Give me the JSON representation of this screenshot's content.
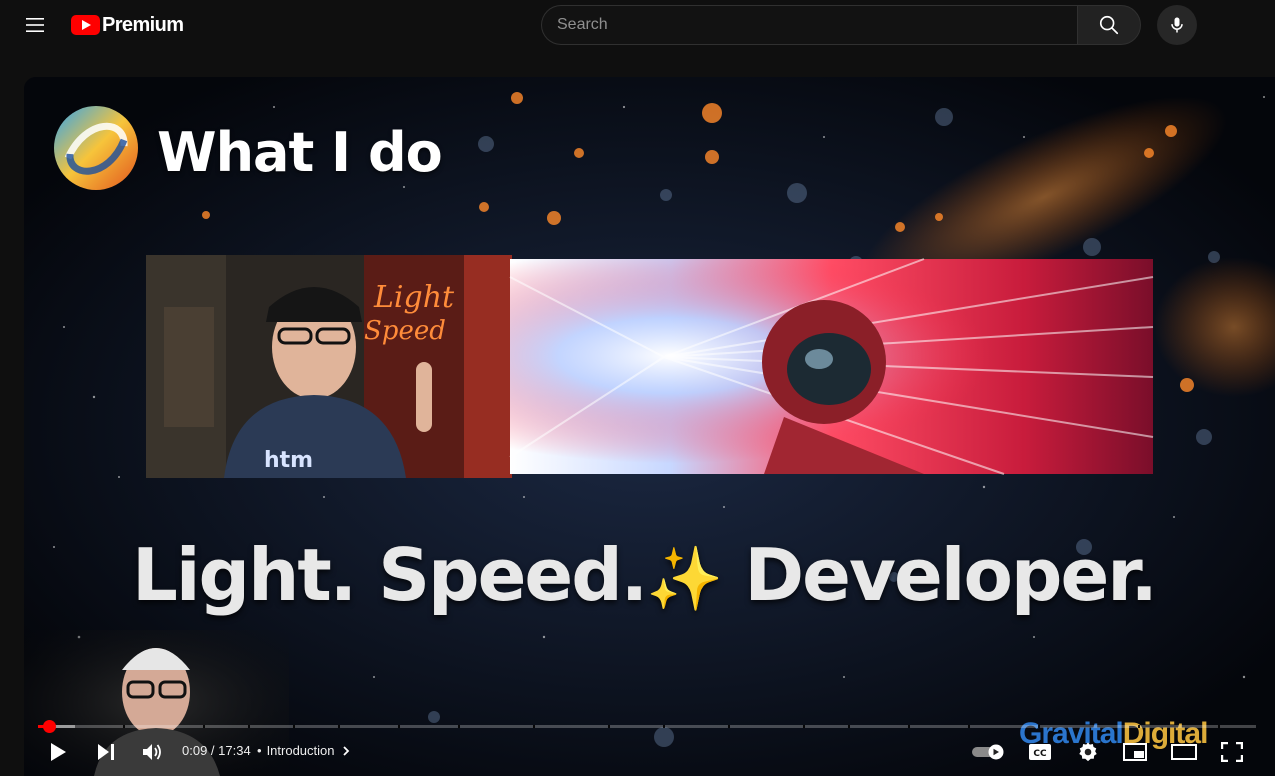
{
  "header": {
    "brand": "Premium",
    "search_placeholder": "Search"
  },
  "video": {
    "slide_title": "What I do",
    "tagline": "Light. Speed.",
    "tagline_emoji": "✨",
    "tagline_end": " Developer.",
    "neon_sign": "Light Speed",
    "watermark_part1": "Gravital",
    "watermark_part2": "Digital"
  },
  "player": {
    "current_time": "0:09",
    "duration": "17:34",
    "time_separator": " / ",
    "chapter_title": "Introduction",
    "progress_played_fraction": 0.009,
    "progress_loaded_fraction": 0.03,
    "autoplay": true
  },
  "colors": {
    "accent": "#ff0000",
    "background": "#0f0f0f",
    "search_border": "#303030"
  }
}
